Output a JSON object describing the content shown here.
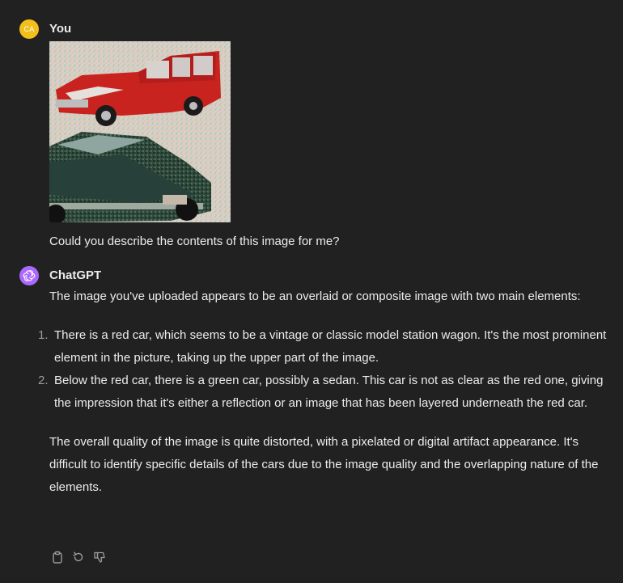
{
  "user_message": {
    "avatar_initials": "CA",
    "author": "You",
    "image_alt": "red car and green car composite",
    "text": "Could you describe the contents of this image for me?"
  },
  "assistant_message": {
    "author": "ChatGPT",
    "intro": "The image you've uploaded appears to be an overlaid or composite image with two main elements:",
    "list": [
      {
        "num": "1.",
        "text": "There is a red car, which seems to be a vintage or classic model station wagon. It's the most prominent element in the picture, taking up the upper part of the image."
      },
      {
        "num": "2.",
        "text": "Below the red car, there is a green car, possibly a sedan. This car is not as clear as the red one, giving the impression that it's either a reflection or an image that has been layered underneath the red car."
      }
    ],
    "outro": "The overall quality of the image is quite distorted, with a pixelated or digital artifact appearance. It's difficult to identify specific details of the cars due to the image quality and the overlapping nature of the elements."
  },
  "actions": [
    {
      "icon": "clipboard-icon",
      "name": "copy"
    },
    {
      "icon": "regenerate-icon",
      "name": "regenerate"
    },
    {
      "icon": "thumbs-down-icon",
      "name": "thumbs-down"
    }
  ],
  "colors": {
    "background": "#212121",
    "text": "#ececec",
    "user_avatar": "#f2bf1b",
    "gpt_avatar": "#ab68ff",
    "muted": "#9b9b9b"
  }
}
